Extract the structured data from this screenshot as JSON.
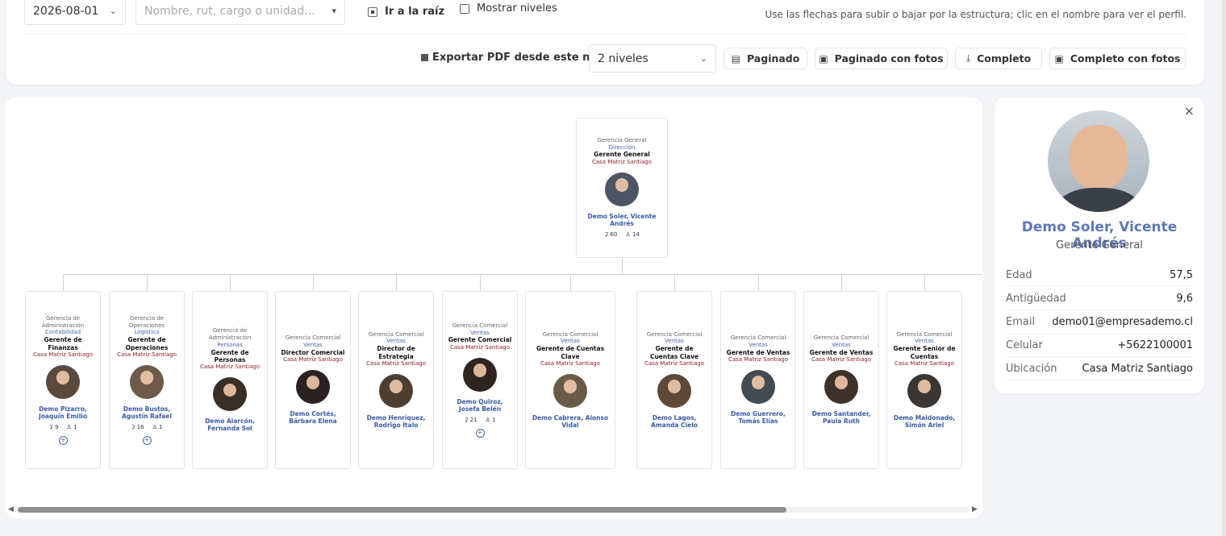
{
  "toolbar": {
    "date_value": "2026-08-01",
    "search_placeholder": "Nombre, rut, cargo o unidad...",
    "goto_root_label": "Ir a la raíz",
    "show_levels_label": "Mostrar niveles",
    "hint": "Use las flechas para subir o bajar por la estructura; clic en el nombre para ver el perfil.",
    "export_label": "Exportar PDF desde este nodo",
    "levels_value": "2 niveles",
    "btn_paged": "Paginado",
    "btn_paged_photos": "Paginado con fotos",
    "btn_complete": "Completo",
    "btn_complete_photos": "Completo con fotos"
  },
  "root": {
    "dept": "Gerencia General",
    "unit": "Dirección",
    "position": "Gerente General",
    "location": "Casa Matriz Santiago",
    "name": "Demo Soler, Vicente Andrés",
    "count_a": "60",
    "count_b": "14"
  },
  "children": [
    {
      "dept": "Gerencia de Administración",
      "unit": "Contabilidad",
      "position": "Gerente de Finanzas",
      "location": "Casa Matriz Santiago",
      "name": "Demo Pizarro, Joaquín Emilio",
      "count_a": "9",
      "count_b": "1",
      "expand": "+"
    },
    {
      "dept": "Gerencia de Operaciones",
      "unit": "Logística",
      "position": "Gerente de Operaciones",
      "location": "Casa Matriz Santiago",
      "name": "Demo Bustos, Agustín Rafael",
      "count_a": "16",
      "count_b": "1",
      "expand": "+"
    },
    {
      "dept": "Gerencia de Administración",
      "unit": "Personas",
      "position": "Gerente de Personas",
      "location": "Casa Matriz Santiago",
      "name": "Demo Alarcón, Fernanda Sol"
    },
    {
      "dept": "Gerencia Comercial",
      "unit": "Ventas",
      "position": "Director Comercial",
      "location": "Casa Matriz Santiago",
      "name": "Demo Cortés, Bárbara Elena"
    },
    {
      "dept": "Gerencia Comercial",
      "unit": "Ventas",
      "position": "Director de Estrategia",
      "location": "Casa Matriz Santiago",
      "name": "Demo Henríquez, Rodrigo Ítalo"
    },
    {
      "dept": "Gerencia Comercial",
      "unit": "Ventas",
      "position": "Gerente Comercial",
      "location": "Casa Matriz Santiago",
      "name": "Demo Quiroz, Josefa Belén",
      "count_a": "21",
      "count_b": "1",
      "expand": "+"
    },
    {
      "dept": "Gerencia Comercial",
      "unit": "Ventas",
      "position": "Gerente de Cuentas Clave",
      "location": "Casa Matriz Santiago",
      "name": "Demo Cabrera, Alonso Vidal"
    },
    {
      "dept": "Gerencia Comercial",
      "unit": "Ventas",
      "position": "Gerente de Cuentas Clave",
      "location": "Casa Matriz Santiago",
      "name": "Demo Lagos, Amanda Cielo"
    },
    {
      "dept": "Gerencia Comercial",
      "unit": "Ventas",
      "position": "Gerente de Ventas",
      "location": "Casa Matriz Santiago",
      "name": "Demo Guerrero, Tomás Elías"
    },
    {
      "dept": "Gerencia Comercial",
      "unit": "Ventas",
      "position": "Gerente de Ventas",
      "location": "Casa Matriz Santiago",
      "name": "Demo Santander, Paula Ruth"
    },
    {
      "dept": "Gerencia Comercial",
      "unit": "Ventas",
      "position": "Gerente Senior de Cuentas",
      "location": "Casa Matriz Santiago",
      "name": "Demo Maldonado, Simón Ariel"
    }
  ],
  "profile": {
    "close": "×",
    "name": "Demo Soler, Vicente Andrés",
    "title": "Gerente General",
    "fields": [
      {
        "label": "Edad",
        "value": "57,5"
      },
      {
        "label": "Antigüedad",
        "value": "9,6"
      },
      {
        "label": "Email",
        "value": "demo01@empresademo.cl"
      },
      {
        "label": "Celular",
        "value": "+5622100001"
      },
      {
        "label": "Ubicación",
        "value": "Casa Matriz Santiago"
      }
    ]
  },
  "icons": {
    "chevron": "⌄",
    "people": "⚇",
    "person": "♙",
    "download": "⤓"
  },
  "colors": {
    "link_blue": "#4a67a3",
    "location_red": "#8d1f2b",
    "name_blue": "#5b78b8"
  }
}
